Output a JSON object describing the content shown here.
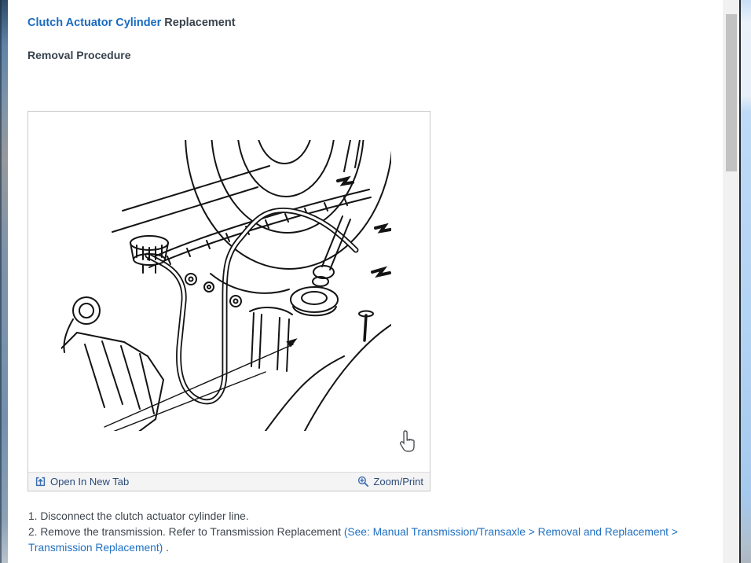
{
  "header": {
    "title_link": "Clutch Actuator Cylinder",
    "title_rest": " Replacement",
    "subtitle": "Removal Procedure"
  },
  "figure": {
    "open_label": "Open In New Tab",
    "zoom_label": "Zoom/Print"
  },
  "steps": [
    {
      "text": "1. Disconnect the clutch actuator cylinder line."
    },
    {
      "lead": "2. Remove the transmission. Refer to Transmission Replacement ",
      "link": "(See: Manual Transmission/Transaxle > Removal and Replacement > Transmission Replacement)",
      "tail": " ."
    }
  ],
  "colors": {
    "link_blue": "#1a6bc0",
    "step_link_blue": "#1e70c2",
    "heading_dark": "#39434d",
    "footer_text": "#2b4a7a",
    "icon_blue": "#3d6eb0",
    "footer_bg": "#f4f4f4",
    "scroll_thumb": "#c2c2c2",
    "edge_steel_blue": "#7490ad",
    "edge_light_blue": "#b4d4f3"
  }
}
